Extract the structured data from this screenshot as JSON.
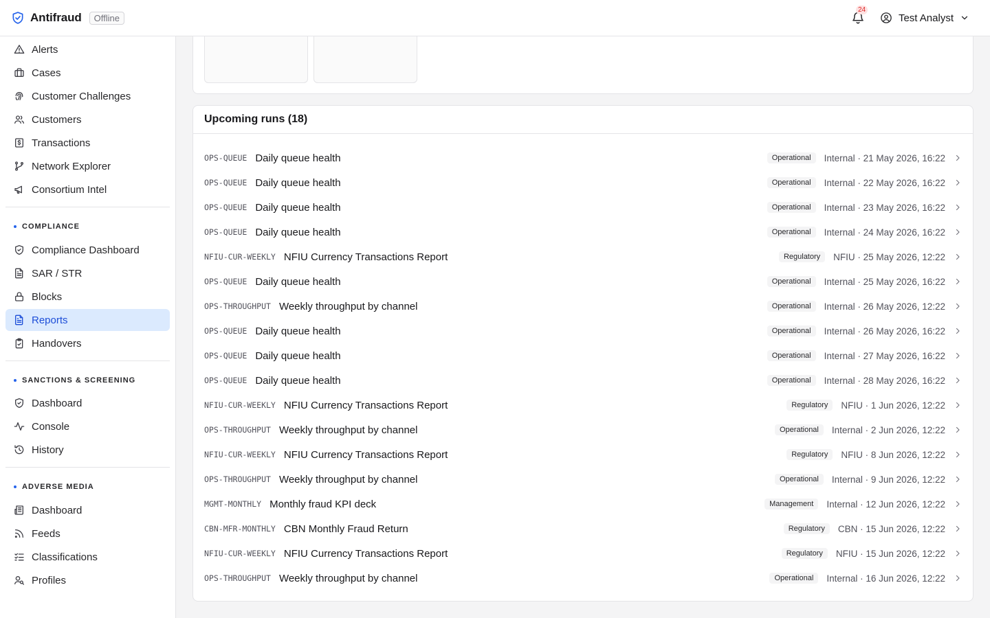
{
  "app": {
    "name": "Antifraud",
    "status": "Offline"
  },
  "header": {
    "notification_count": "24",
    "user_name": "Test Analyst"
  },
  "colors": {
    "accent": "#2563eb",
    "active_bg": "#dbeafe",
    "badge": "#dc2626"
  },
  "sidebar": {
    "main_items": [
      {
        "label": "Alerts",
        "icon": "alert-triangle-icon"
      },
      {
        "label": "Cases",
        "icon": "briefcase-icon"
      },
      {
        "label": "Customer Challenges",
        "icon": "fingerprint-icon"
      },
      {
        "label": "Customers",
        "icon": "users-icon"
      },
      {
        "label": "Transactions",
        "icon": "receipt-icon"
      },
      {
        "label": "Network Explorer",
        "icon": "git-branch-icon"
      },
      {
        "label": "Consortium Intel",
        "icon": "megaphone-icon"
      }
    ],
    "compliance": {
      "title": "COMPLIANCE",
      "items": [
        {
          "label": "Compliance Dashboard",
          "icon": "shield-check-icon"
        },
        {
          "label": "SAR / STR",
          "icon": "file-text-icon"
        },
        {
          "label": "Blocks",
          "icon": "lock-icon"
        },
        {
          "label": "Reports",
          "icon": "report-icon",
          "active": true
        },
        {
          "label": "Handovers",
          "icon": "clipboard-check-icon"
        }
      ]
    },
    "sanctions": {
      "title": "SANCTIONS & SCREENING",
      "items": [
        {
          "label": "Dashboard",
          "icon": "shield-check-icon"
        },
        {
          "label": "Console",
          "icon": "activity-icon"
        },
        {
          "label": "History",
          "icon": "history-icon"
        }
      ]
    },
    "adverse": {
      "title": "ADVERSE MEDIA",
      "items": [
        {
          "label": "Dashboard",
          "icon": "newspaper-icon"
        },
        {
          "label": "Feeds",
          "icon": "rss-icon"
        },
        {
          "label": "Classifications",
          "icon": "list-checks-icon"
        },
        {
          "label": "Profiles",
          "icon": "user-search-icon"
        }
      ]
    }
  },
  "upcoming": {
    "title": "Upcoming runs (18)",
    "runs": [
      {
        "code": "OPS-QUEUE",
        "name": "Daily queue health",
        "tag": "Operational",
        "meta": "Internal · 21 May 2026, 16:22"
      },
      {
        "code": "OPS-QUEUE",
        "name": "Daily queue health",
        "tag": "Operational",
        "meta": "Internal · 22 May 2026, 16:22"
      },
      {
        "code": "OPS-QUEUE",
        "name": "Daily queue health",
        "tag": "Operational",
        "meta": "Internal · 23 May 2026, 16:22"
      },
      {
        "code": "OPS-QUEUE",
        "name": "Daily queue health",
        "tag": "Operational",
        "meta": "Internal · 24 May 2026, 16:22"
      },
      {
        "code": "NFIU-CUR-WEEKLY",
        "name": "NFIU Currency Transactions Report",
        "tag": "Regulatory",
        "meta": "NFIU · 25 May 2026, 12:22"
      },
      {
        "code": "OPS-QUEUE",
        "name": "Daily queue health",
        "tag": "Operational",
        "meta": "Internal · 25 May 2026, 16:22"
      },
      {
        "code": "OPS-THROUGHPUT",
        "name": "Weekly throughput by channel",
        "tag": "Operational",
        "meta": "Internal · 26 May 2026, 12:22"
      },
      {
        "code": "OPS-QUEUE",
        "name": "Daily queue health",
        "tag": "Operational",
        "meta": "Internal · 26 May 2026, 16:22"
      },
      {
        "code": "OPS-QUEUE",
        "name": "Daily queue health",
        "tag": "Operational",
        "meta": "Internal · 27 May 2026, 16:22"
      },
      {
        "code": "OPS-QUEUE",
        "name": "Daily queue health",
        "tag": "Operational",
        "meta": "Internal · 28 May 2026, 16:22"
      },
      {
        "code": "NFIU-CUR-WEEKLY",
        "name": "NFIU Currency Transactions Report",
        "tag": "Regulatory",
        "meta": "NFIU · 1 Jun 2026, 12:22"
      },
      {
        "code": "OPS-THROUGHPUT",
        "name": "Weekly throughput by channel",
        "tag": "Operational",
        "meta": "Internal · 2 Jun 2026, 12:22"
      },
      {
        "code": "NFIU-CUR-WEEKLY",
        "name": "NFIU Currency Transactions Report",
        "tag": "Regulatory",
        "meta": "NFIU · 8 Jun 2026, 12:22"
      },
      {
        "code": "OPS-THROUGHPUT",
        "name": "Weekly throughput by channel",
        "tag": "Operational",
        "meta": "Internal · 9 Jun 2026, 12:22"
      },
      {
        "code": "MGMT-MONTHLY",
        "name": "Monthly fraud KPI deck",
        "tag": "Management",
        "meta": "Internal · 12 Jun 2026, 12:22"
      },
      {
        "code": "CBN-MFR-MONTHLY",
        "name": "CBN Monthly Fraud Return",
        "tag": "Regulatory",
        "meta": "CBN · 15 Jun 2026, 12:22"
      },
      {
        "code": "NFIU-CUR-WEEKLY",
        "name": "NFIU Currency Transactions Report",
        "tag": "Regulatory",
        "meta": "NFIU · 15 Jun 2026, 12:22"
      },
      {
        "code": "OPS-THROUGHPUT",
        "name": "Weekly throughput by channel",
        "tag": "Operational",
        "meta": "Internal · 16 Jun 2026, 12:22"
      }
    ]
  }
}
